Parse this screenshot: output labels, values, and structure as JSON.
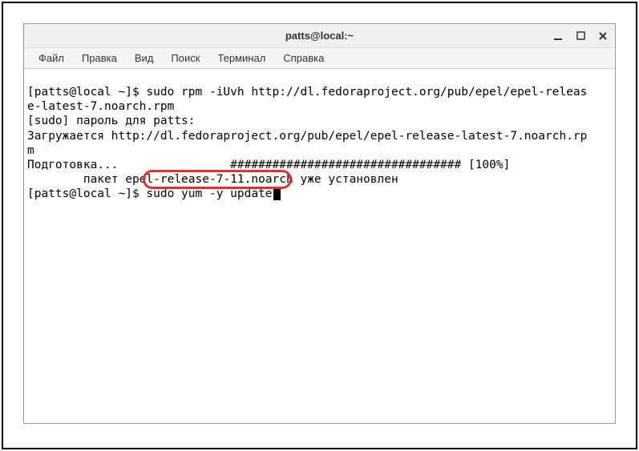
{
  "window": {
    "title": "patts@local:~"
  },
  "menu": {
    "file": "Файл",
    "edit": "Правка",
    "view": "Вид",
    "search": "Поиск",
    "terminal": "Терминал",
    "help": "Справка"
  },
  "terminal": {
    "line1": "[patts@local ~]$ sudo rpm -iUvh http://dl.fedoraproject.org/pub/epel/epel-releas",
    "line2": "e-latest-7.noarch.rpm",
    "line3": "[sudo] пароль для patts:",
    "line4": "Загружается http://dl.fedoraproject.org/pub/epel/epel-release-latest-7.noarch.rp",
    "line5": "m",
    "line6": "Подготовка...                ################################# [100%]",
    "line7": "        пакет epel-release-7-11.noarch уже установлен",
    "line8_prompt": "[patts@local ~]$ ",
    "line8_cmd": "sudo yum -y update"
  },
  "highlight": {
    "command": "sudo yum -y update"
  }
}
